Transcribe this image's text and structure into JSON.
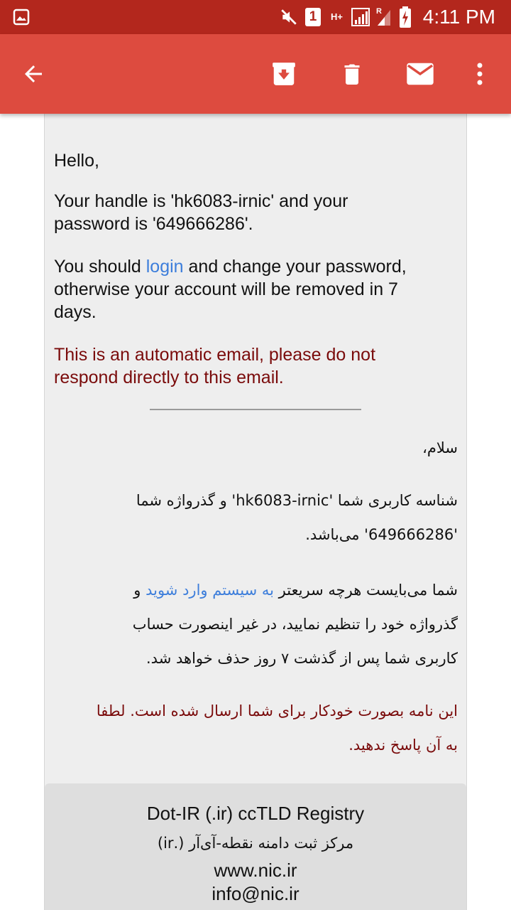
{
  "status_bar": {
    "time": "4:11 PM",
    "notification_count": "1",
    "network_label": "H+",
    "roaming_label": "R",
    "icons": [
      "image-icon",
      "mute-icon",
      "sim-icon",
      "data-icon",
      "signal-icon",
      "signal-roaming-icon",
      "battery-charging-icon"
    ]
  },
  "toolbar": {
    "icons": [
      "back-arrow-icon",
      "archive-icon",
      "delete-icon",
      "mail-icon",
      "more-vert-icon"
    ],
    "bg_color": "#dd4b3f",
    "status_color": "#b3271d"
  },
  "email": {
    "greeting": "Hello,",
    "handle_line_1": "Your handle is 'hk6083-irnic' and your",
    "handle_line_2": "password is '649666286'.",
    "should_prefix": "You should ",
    "login_link": "login",
    "should_suffix": " and change your password,",
    "should_line_2": "otherwise your account will be removed in 7",
    "should_line_3": "days.",
    "auto_line_1": "This is an automatic email, please do not",
    "auto_line_2": "respond directly to this email.",
    "fa_greeting": "سلام،",
    "fa_handle_line_1": "شناسه کاربری شما 'hk6083-irnic' و گذرواژه شما",
    "fa_handle_line_2": "'649666286' می‌باشد.",
    "fa_should_prefix": "شما می‌بایست هرچه سریعتر ",
    "fa_login_link": "به سیستم وارد شوید",
    "fa_should_suffix": " و",
    "fa_should_line_2": "گذرواژه خود را تنظیم نمایید، در غیر اینصورت حساب",
    "fa_should_line_3": "کاربری شما پس از گذشت ۷ روز حذف خواهد شد.",
    "fa_auto_line_1": "این نامه بصورت خودکار برای شما ارسال شده است. لطفا",
    "fa_auto_line_2": "به آن پاسخ ندهید.",
    "footer_title": "Dot-IR (.ir) ccTLD Registry",
    "footer_title_fa": "مرکز ثبت دامنه نقطه-آی‌آر (.ir)",
    "footer_website": "www.nic.ir",
    "footer_email": "info@nic.ir",
    "link_color": "#3d7edb",
    "warning_color": "#7a0b0b"
  }
}
